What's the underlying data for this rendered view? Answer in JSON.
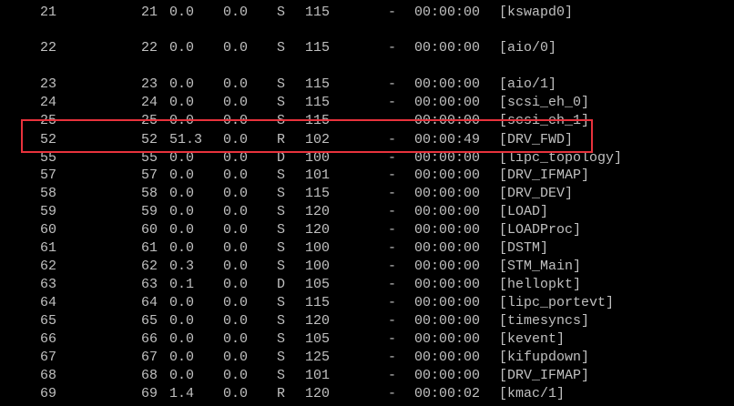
{
  "colors": {
    "background": "#000000",
    "text": "#c0c0c0",
    "highlight": "#e8323c"
  },
  "rows": [
    {
      "pid": "21",
      "tid": "21",
      "cpu": "0.0",
      "mem": "0.0",
      "state": "S",
      "pri": "115",
      "dash": "-",
      "time": "00:00:00",
      "cmd": "[kswapd0]"
    },
    {
      "pid": "22",
      "tid": "22",
      "cpu": "0.0",
      "mem": "0.0",
      "state": "S",
      "pri": "115",
      "dash": "-",
      "time": "00:00:00",
      "cmd": "[aio/0]"
    },
    {
      "pid": "23",
      "tid": "23",
      "cpu": "0.0",
      "mem": "0.0",
      "state": "S",
      "pri": "115",
      "dash": "-",
      "time": "00:00:00",
      "cmd": "[aio/1]"
    },
    {
      "pid": "24",
      "tid": "24",
      "cpu": "0.0",
      "mem": "0.0",
      "state": "S",
      "pri": "115",
      "dash": "-",
      "time": "00:00:00",
      "cmd": "[scsi_eh_0]"
    },
    {
      "pid": "25",
      "tid": "25",
      "cpu": "0.0",
      "mem": "0.0",
      "state": "S",
      "pri": "115",
      "dash": "-",
      "time": "00:00:00",
      "cmd": "[scsi_eh_1]"
    },
    {
      "pid": "52",
      "tid": "52",
      "cpu": "51.3",
      "mem": "0.0",
      "state": "R",
      "pri": "102",
      "dash": "-",
      "time": "00:00:49",
      "cmd": "[DRV_FWD]"
    },
    {
      "pid": "55",
      "tid": "55",
      "cpu": "0.0",
      "mem": "0.0",
      "state": "D",
      "pri": "100",
      "dash": "-",
      "time": "00:00:00",
      "cmd": "[lipc_topology]"
    },
    {
      "pid": "57",
      "tid": "57",
      "cpu": "0.0",
      "mem": "0.0",
      "state": "S",
      "pri": "101",
      "dash": "-",
      "time": "00:00:00",
      "cmd": "[DRV_IFMAP]"
    },
    {
      "pid": "58",
      "tid": "58",
      "cpu": "0.0",
      "mem": "0.0",
      "state": "S",
      "pri": "115",
      "dash": "-",
      "time": "00:00:00",
      "cmd": "[DRV_DEV]"
    },
    {
      "pid": "59",
      "tid": "59",
      "cpu": "0.0",
      "mem": "0.0",
      "state": "S",
      "pri": "120",
      "dash": "-",
      "time": "00:00:00",
      "cmd": "[LOAD]"
    },
    {
      "pid": "60",
      "tid": "60",
      "cpu": "0.0",
      "mem": "0.0",
      "state": "S",
      "pri": "120",
      "dash": "-",
      "time": "00:00:00",
      "cmd": "[LOADProc]"
    },
    {
      "pid": "61",
      "tid": "61",
      "cpu": "0.0",
      "mem": "0.0",
      "state": "S",
      "pri": "100",
      "dash": "-",
      "time": "00:00:00",
      "cmd": "[DSTM]"
    },
    {
      "pid": "62",
      "tid": "62",
      "cpu": "0.3",
      "mem": "0.0",
      "state": "S",
      "pri": "100",
      "dash": "-",
      "time": "00:00:00",
      "cmd": "[STM_Main]"
    },
    {
      "pid": "63",
      "tid": "63",
      "cpu": "0.1",
      "mem": "0.0",
      "state": "D",
      "pri": "105",
      "dash": "-",
      "time": "00:00:00",
      "cmd": "[hellopkt]"
    },
    {
      "pid": "64",
      "tid": "64",
      "cpu": "0.0",
      "mem": "0.0",
      "state": "S",
      "pri": "115",
      "dash": "-",
      "time": "00:00:00",
      "cmd": "[lipc_portevt]"
    },
    {
      "pid": "65",
      "tid": "65",
      "cpu": "0.0",
      "mem": "0.0",
      "state": "S",
      "pri": "120",
      "dash": "-",
      "time": "00:00:00",
      "cmd": "[timesyncs]"
    },
    {
      "pid": "66",
      "tid": "66",
      "cpu": "0.0",
      "mem": "0.0",
      "state": "S",
      "pri": "105",
      "dash": "-",
      "time": "00:00:00",
      "cmd": "[kevent]"
    },
    {
      "pid": "67",
      "tid": "67",
      "cpu": "0.0",
      "mem": "0.0",
      "state": "S",
      "pri": "125",
      "dash": "-",
      "time": "00:00:00",
      "cmd": "[kifupdown]"
    },
    {
      "pid": "68",
      "tid": "68",
      "cpu": "0.0",
      "mem": "0.0",
      "state": "S",
      "pri": "101",
      "dash": "-",
      "time": "00:00:00",
      "cmd": "[DRV_IFMAP]"
    },
    {
      "pid": "69",
      "tid": "69",
      "cpu": "1.4",
      "mem": "0.0",
      "state": "R",
      "pri": "120",
      "dash": "-",
      "time": "00:00:02",
      "cmd": "[kmac/1]"
    }
  ]
}
